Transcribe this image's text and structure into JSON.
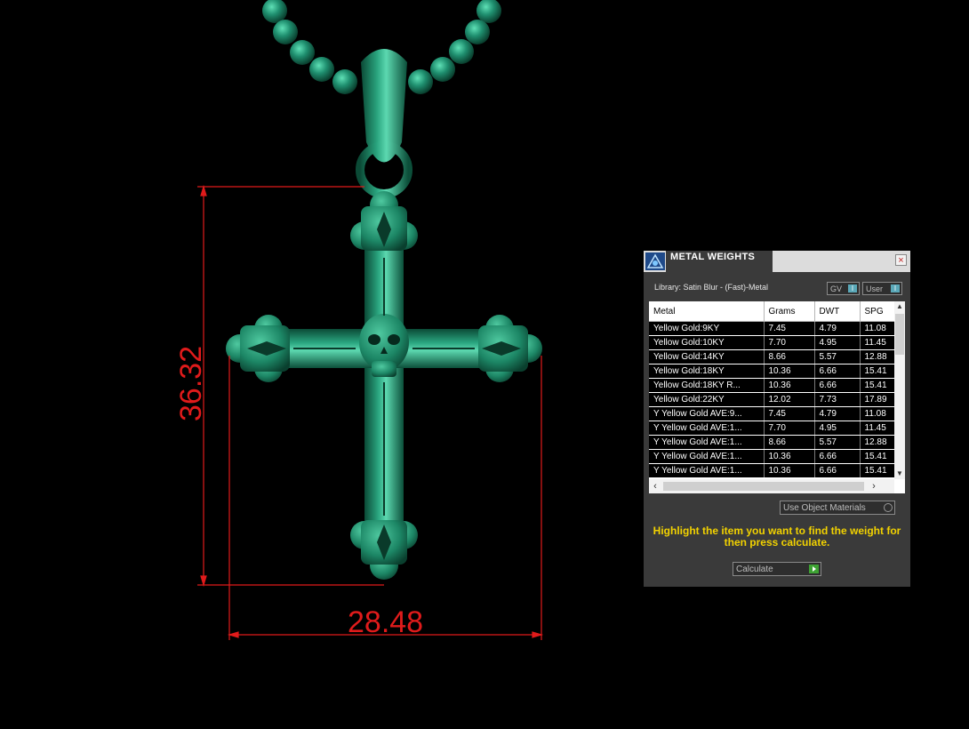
{
  "viewport": {
    "dimension_height": "36.32",
    "dimension_width": "28.48",
    "model_color": "#1f8f6f",
    "dimension_color": "#e01b1b"
  },
  "panel": {
    "title": "METAL WEIGHTS",
    "close_glyph": "×",
    "library_label": "Library: Satin Blur - (Fast)-Metal",
    "gv_toggle": "GV",
    "user_toggle": "User",
    "columns": [
      "Metal",
      "Grams",
      "DWT",
      "SPG"
    ],
    "rows": [
      [
        "Yellow Gold:9KY",
        "7.45",
        "4.79",
        "11.08"
      ],
      [
        "Yellow Gold:10KY",
        "7.70",
        "4.95",
        "11.45"
      ],
      [
        "Yellow Gold:14KY",
        "8.66",
        "5.57",
        "12.88"
      ],
      [
        "Yellow Gold:18KY",
        "10.36",
        "6.66",
        "15.41"
      ],
      [
        "Yellow Gold:18KY R...",
        "10.36",
        "6.66",
        "15.41"
      ],
      [
        "Yellow Gold:22KY",
        "12.02",
        "7.73",
        "17.89"
      ],
      [
        "Y Yellow Gold AVE:9...",
        "7.45",
        "4.79",
        "11.08"
      ],
      [
        "Y Yellow Gold AVE:1...",
        "7.70",
        "4.95",
        "11.45"
      ],
      [
        "Y Yellow Gold AVE:1...",
        "8.66",
        "5.57",
        "12.88"
      ],
      [
        "Y Yellow Gold AVE:1...",
        "10.36",
        "6.66",
        "15.41"
      ],
      [
        "Y Yellow Gold AVE:1...",
        "10.36",
        "6.66",
        "15.41"
      ]
    ],
    "use_object_materials": "Use Object Materials",
    "instructions": "Highlight the item you want to find the weight for then press calculate.",
    "calculate_label": "Calculate",
    "icons": [
      "app-logo-icon",
      "close-icon",
      "scroll-up-icon",
      "scroll-down-icon",
      "scroll-left-icon",
      "scroll-right-icon",
      "play-icon"
    ],
    "accent_color": "#f2d200"
  }
}
